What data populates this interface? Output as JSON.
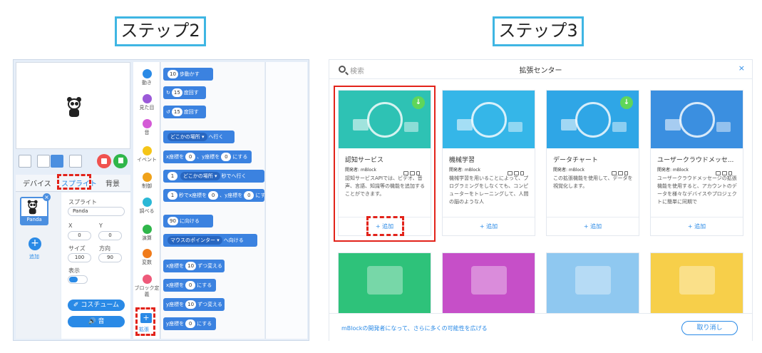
{
  "steps": {
    "step2": "ステップ2",
    "step3": "ステップ3"
  },
  "editor": {
    "tabs": {
      "devices": "デバイス",
      "sprites": "スプライト",
      "backdrops": "背景"
    },
    "sprite": {
      "name": "Panda",
      "add_label": "追加",
      "x_mark": "×",
      "plus": "+"
    },
    "props": {
      "sprite_label": "スプライト",
      "sprite_value": "Panda",
      "x_label": "X",
      "x_value": "0",
      "y_label": "Y",
      "y_value": "0",
      "size_label": "サイズ",
      "size_value": "100",
      "dir_label": "方向",
      "dir_value": "90",
      "show_label": "表示",
      "costume_btn": "✐ コスチューム",
      "sound_btn": "🔊 音"
    },
    "categories": [
      {
        "label": "動き",
        "color": "#2a8ae6"
      },
      {
        "label": "見た目",
        "color": "#9b59d8"
      },
      {
        "label": "音",
        "color": "#d45ad6"
      },
      {
        "label": "イベント",
        "color": "#f5c518"
      },
      {
        "label": "制御",
        "color": "#f0a21a"
      },
      {
        "label": "調べる",
        "color": "#2bb8d6"
      },
      {
        "label": "演算",
        "color": "#2fb64a"
      },
      {
        "label": "変数",
        "color": "#f07b1a"
      },
      {
        "label": "ブロック定義",
        "color": "#ee5a7a"
      }
    ],
    "ext_button": {
      "plus": "+",
      "label": "拡張"
    },
    "blocks": [
      {
        "pre": "",
        "num1": "10",
        "mid": "歩動かす"
      },
      {
        "pre": "↻",
        "num1": "15",
        "mid": "度回す"
      },
      {
        "pre": "↺",
        "num1": "15",
        "mid": "度回す"
      },
      {
        "dd": "どこかの場所 ▾",
        "mid": "へ行く"
      },
      {
        "pre": "x座標を",
        "num1": "0",
        "mid": "、y座標を",
        "num2": "0",
        "post": "にする"
      },
      {
        "num1": "1",
        "mid": "秒で",
        "dd": "どこかの場所 ▾",
        "post": "へ行く"
      },
      {
        "num1": "1",
        "mid": "秒でx座標を",
        "num2": "0",
        "mid2": "、y座標を",
        "num3": "0",
        "post": "にする"
      },
      {
        "num1": "90",
        "mid": "に向ける"
      },
      {
        "dd": "マウスのポインター ▾",
        "mid": "へ向ける"
      },
      {
        "pre": "x座標を",
        "num1": "10",
        "mid": "ずつ変える"
      },
      {
        "pre": "x座標を",
        "num1": "0",
        "mid": "にする"
      },
      {
        "pre": "y座標を",
        "num1": "10",
        "mid": "ずつ変える"
      },
      {
        "pre": "y座標を",
        "num1": "0",
        "mid": "にする"
      }
    ]
  },
  "extension_center": {
    "search_placeholder": "検索",
    "title": "拡張センター",
    "close": "×",
    "cards": [
      {
        "title": "認知サービス",
        "dev": "開発者: mBlock",
        "desc": "認知サービスAPIでは、ビデオ、音声、言語、知識等の機能を追加することができます。",
        "add": "+ 追加",
        "bg": "#2ec2b4",
        "badge": true
      },
      {
        "title": "機械学習",
        "dev": "開発者: mBlock",
        "desc": "機械学習を用いることによって、プログラミングをしなくても、コンピューターをトレーニングして、人間の脳のような人",
        "add": "+ 追加",
        "bg": "#35b6e8",
        "badge": false
      },
      {
        "title": "データチャート",
        "dev": "開発者: mBlock",
        "desc": "この拡張機能を使用して、データを視覚化します。",
        "add": "+ 追加",
        "bg": "#2fa6e6",
        "badge": true
      },
      {
        "title": "ユーザークラウドメッセ...",
        "dev": "開発者: mBlock",
        "desc": "ユーザークラウドメッセージの拡張機能を使用すると、アカウントのデータを様々なデバイスやプロジェクトに簡単に同期で",
        "add": "+ 追加",
        "bg": "#3b8fe0",
        "badge": false
      }
    ],
    "row2_colors": [
      "#2ec27a",
      "#c64fc8",
      "#8fc8f0",
      "#f7cf4a"
    ],
    "footer_link": "mBlockの開発者になって、さらに多くの可能性を広げる",
    "cancel": "取り消し"
  },
  "colors": {
    "accent": "#2a8ae6",
    "highlight": "#e2231a",
    "step_border": "#3fb6e3"
  }
}
